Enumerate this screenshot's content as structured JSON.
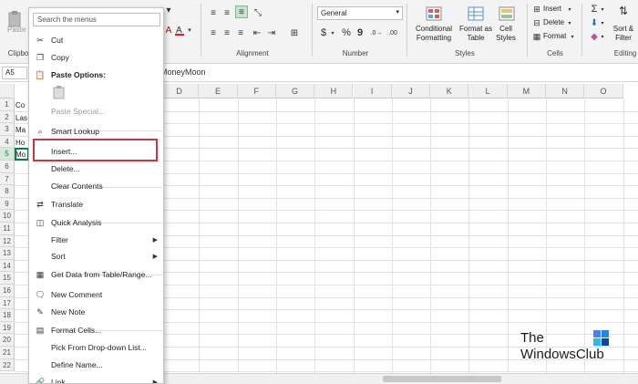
{
  "ribbon": {
    "paste_label": "Paste",
    "clipboard_label": "Clipbo",
    "alignment_label": "Alignment",
    "number_label": "Number",
    "number_format": "General",
    "number_symbols": {
      "currency": "$",
      "percent": "%",
      "comma": "9"
    },
    "styles_label": "Styles",
    "conditional_formatting": "Conditional Formatting",
    "format_as_table": "Format as Table",
    "cell_styles": "Cell Styles",
    "cells_label": "Cells",
    "insert": "Insert",
    "delete": "Delete",
    "format": "Format",
    "editing_label": "Editing",
    "sort_filter": "Sort & Filter"
  },
  "formula_bar": {
    "name_box": "A5",
    "value": "MoneyMoon"
  },
  "columns": [
    "D",
    "E",
    "F",
    "G",
    "H",
    "I",
    "J",
    "K",
    "L",
    "M",
    "N",
    "O"
  ],
  "rows": [
    "1",
    "2",
    "3",
    "4",
    "5",
    "6",
    "7",
    "8",
    "9",
    "10",
    "11",
    "12",
    "13",
    "14",
    "15",
    "16",
    "17",
    "18",
    "19",
    "20",
    "21",
    "22"
  ],
  "cells_a": [
    "Co",
    "Las",
    "Ma",
    "Ho",
    "Mo"
  ],
  "context_menu": {
    "search_placeholder": "Search the menus",
    "items": [
      {
        "label": "Cut",
        "icon": "scissors-icon"
      },
      {
        "label": "Copy",
        "icon": "copy-icon"
      },
      {
        "label": "Paste Options:",
        "icon": "paste-icon",
        "bold": true
      },
      {
        "label": "Paste Special...",
        "disabled": true
      },
      {
        "label": "Smart Lookup",
        "icon": "search-icon"
      },
      {
        "label": "Insert..."
      },
      {
        "label": "Delete..."
      },
      {
        "label": "Clear Contents"
      },
      {
        "label": "Translate",
        "icon": "translate-icon"
      },
      {
        "label": "Quick Analysis",
        "icon": "quick-analysis-icon"
      },
      {
        "label": "Filter",
        "submenu": true
      },
      {
        "label": "Sort",
        "submenu": true
      },
      {
        "label": "Get Data from Table/Range...",
        "icon": "table-icon"
      },
      {
        "label": "New Comment",
        "icon": "comment-icon"
      },
      {
        "label": "New Note",
        "icon": "note-icon"
      },
      {
        "label": "Format Cells...",
        "icon": "format-cells-icon"
      },
      {
        "label": "Pick From Drop-down List..."
      },
      {
        "label": "Define Name..."
      },
      {
        "label": "Link",
        "icon": "link-icon",
        "submenu": true
      }
    ]
  },
  "watermark": {
    "line1": "The",
    "line2": "WindowsClub"
  }
}
